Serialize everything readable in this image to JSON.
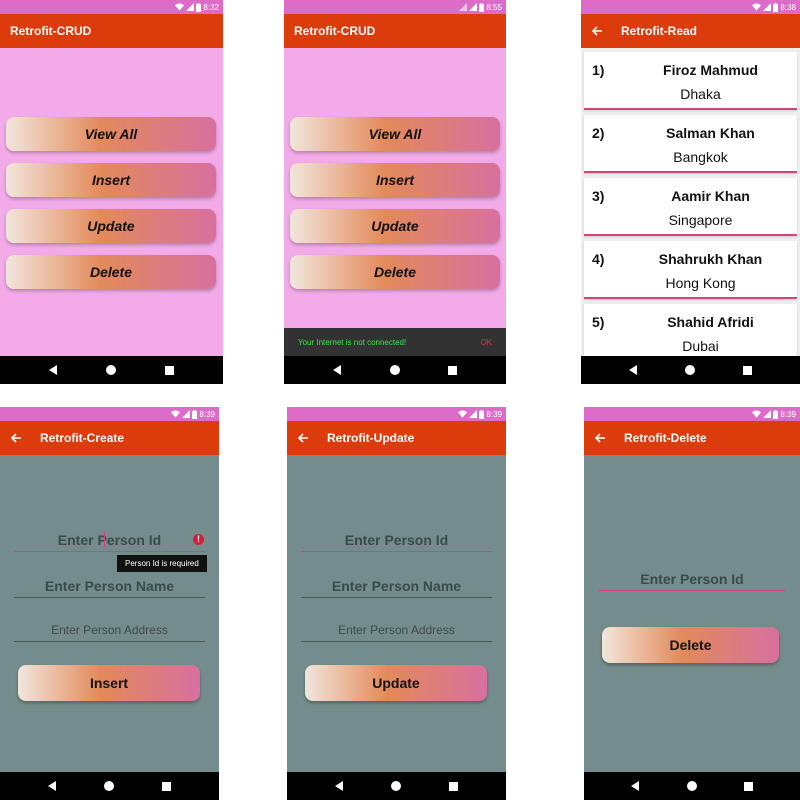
{
  "status_times": [
    "8:32",
    "8:55",
    "8:38",
    "8:39",
    "8:39",
    "8:39"
  ],
  "colors": {
    "status_bar": "#dd6bc8",
    "app_bar": "#dc3b0c",
    "menu_background": "#f2aae8",
    "form_background": "#748d8c",
    "accent": "#d6437c"
  },
  "icons": {
    "back": "arrow-left-icon",
    "wifi": "wifi-icon",
    "signal": "signal-icon",
    "battery": "battery-icon",
    "error": "error-icon"
  },
  "home": {
    "title": "Retrofit-CRUD",
    "buttons": [
      "View All",
      "Insert",
      "Update",
      "Delete"
    ]
  },
  "snackbar": {
    "message": "Your Internet is not connected!",
    "action": "OK"
  },
  "read": {
    "title": "Retrofit-Read",
    "people": [
      {
        "num": "1)",
        "name": "Firoz Mahmud",
        "city": "Dhaka"
      },
      {
        "num": "2)",
        "name": "Salman Khan",
        "city": "Bangkok"
      },
      {
        "num": "3)",
        "name": "Aamir Khan",
        "city": "Singapore"
      },
      {
        "num": "4)",
        "name": "Shahrukh Khan",
        "city": "Hong Kong"
      },
      {
        "num": "5)",
        "name": "Shahid Afridi",
        "city": "Dubai"
      }
    ]
  },
  "create": {
    "title": "Retrofit-Create",
    "id_placeholder": "Enter Person Id",
    "name_placeholder": "Enter Person Name",
    "address_placeholder": "Enter Person Address",
    "error": "Person Id is required",
    "button": "Insert"
  },
  "update": {
    "title": "Retrofit-Update",
    "id_placeholder": "Enter Person Id",
    "name_placeholder": "Enter Person Name",
    "address_placeholder": "Enter Person Address",
    "button": "Update"
  },
  "delete": {
    "title": "Retrofit-Delete",
    "id_placeholder": "Enter Person Id",
    "button": "Delete"
  }
}
